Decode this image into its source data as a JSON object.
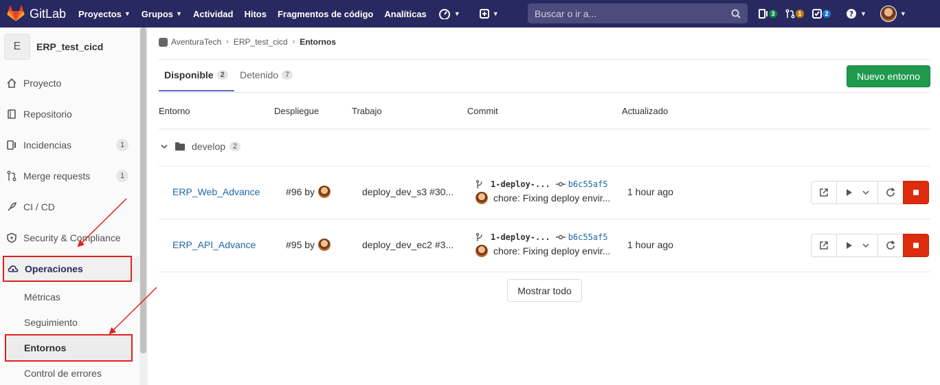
{
  "topbar": {
    "brand": "GitLab",
    "nav": [
      "Proyectos",
      "Grupos",
      "Actividad",
      "Hitos",
      "Fragmentos de código",
      "Analíticas"
    ],
    "search_placeholder": "Buscar o ir a...",
    "issues_count": "3",
    "mr_count": "1",
    "todos_count": "2",
    "colors": {
      "bg": "#292961",
      "issues_badge": "#108548",
      "mr_badge": "#c17d10",
      "todos_badge": "#1f75cb"
    }
  },
  "sidebar": {
    "project_initial": "E",
    "project_name": "ERP_test_cicd",
    "items": [
      {
        "label": "Proyecto",
        "icon": "home-icon"
      },
      {
        "label": "Repositorio",
        "icon": "book-icon"
      },
      {
        "label": "Incidencias",
        "icon": "issues-icon",
        "count": "1"
      },
      {
        "label": "Merge requests",
        "icon": "merge-request-icon",
        "count": "1"
      },
      {
        "label": "CI / CD",
        "icon": "rocket-icon"
      },
      {
        "label": "Security & Compliance",
        "icon": "shield-icon"
      },
      {
        "label": "Operaciones",
        "icon": "cloud-gear-icon"
      }
    ],
    "sub_items": [
      "Métricas",
      "Seguimiento",
      "Entornos",
      "Control de errores"
    ]
  },
  "breadcrumb": {
    "group": "AventuraTech",
    "project": "ERP_test_cicd",
    "current": "Entornos"
  },
  "tabs": [
    {
      "label": "Disponible",
      "count": "2"
    },
    {
      "label": "Detenido",
      "count": "7"
    }
  ],
  "new_env_button": "Nuevo entorno",
  "table": {
    "headers": [
      "Entorno",
      "Despliegue",
      "Trabajo",
      "Commit",
      "Actualizado"
    ],
    "folder": {
      "name": "develop",
      "count": "2"
    },
    "rows": [
      {
        "name": "ERP_Web_Advance",
        "deployment": "#96 by",
        "job": "deploy_dev_s3 #30...",
        "ref": "1-deploy-...",
        "sha": "b6c55af5",
        "message": "chore: Fixing deploy envir...",
        "updated": "1 hour ago"
      },
      {
        "name": "ERP_API_Advance",
        "deployment": "#95 by",
        "job": "deploy_dev_ec2 #3...",
        "ref": "1-deploy-...",
        "sha": "b6c55af5",
        "message": "chore: Fixing deploy envir...",
        "updated": "1 hour ago"
      }
    ]
  },
  "show_all_button": "Mostrar todo"
}
